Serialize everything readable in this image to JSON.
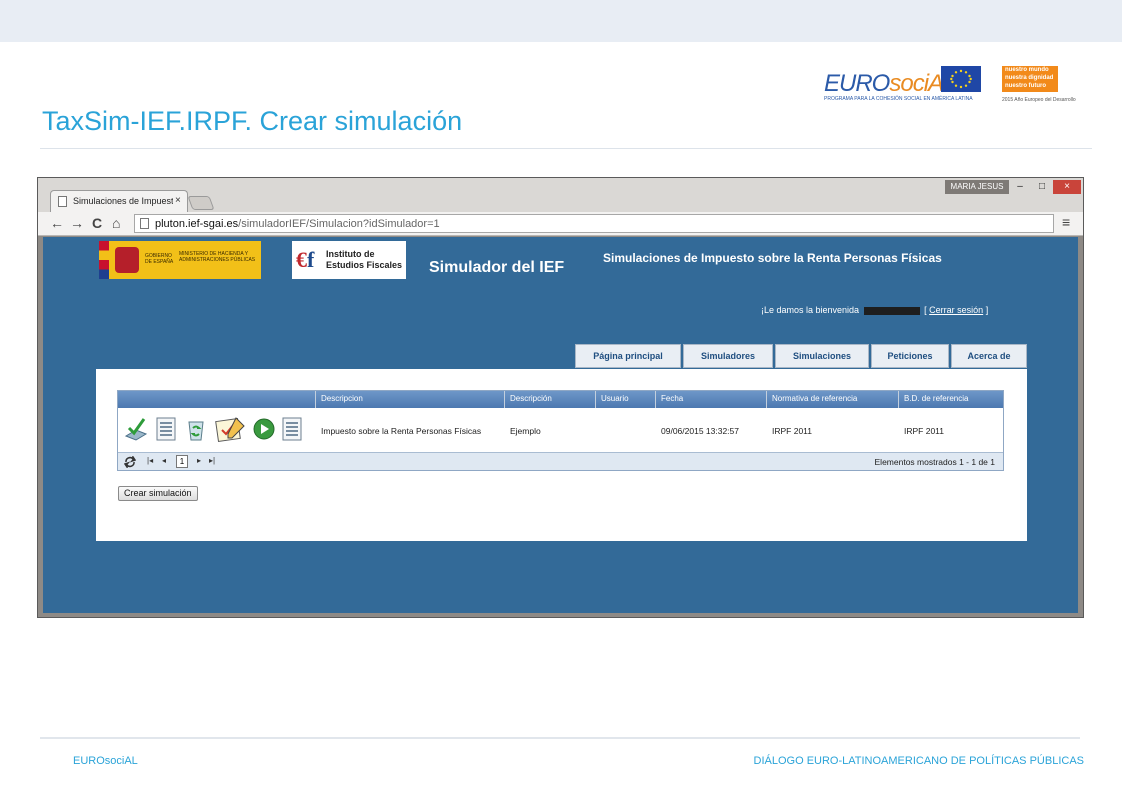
{
  "slide": {
    "title": "TaxSim-IEF.IRPF. Crear simulación",
    "footer_left": "EUROsociAL",
    "footer_right": "DIÁLOGO EURO-LATINOAMERICANO DE POLÍTICAS PÚBLICAS"
  },
  "logos": {
    "eurosocial_euro": "EURO",
    "eurosocial_social": "sociAL",
    "eurosocial_tagline": "PROGRAMA PARA LA COHESIÓN SOCIAL EN AMÉRICA LATINA",
    "nm_lines": [
      "nuestro mundo",
      "nuestra dignidad",
      "nuestro futuro"
    ],
    "nm_footer": "2015 Año Europeo del Desarrollo"
  },
  "browser": {
    "tab_title": "Simulaciones de Impuesto",
    "tab_close": "×",
    "user_badge": "MARIA JESUS",
    "win_min": "–",
    "win_max": "□",
    "win_close": "×",
    "nav_back": "←",
    "nav_forward": "→",
    "nav_reload": "C",
    "nav_home": "⌂",
    "url_host": "pluton.ief-sgai.es",
    "url_path": "/simuladorIEF/Simulacion?idSimulador=1",
    "star": "☆",
    "menu": "≡"
  },
  "page": {
    "gob_text_1": "GOBIERNO DE ESPAÑA",
    "gob_text_2": "MINISTERIO DE HACIENDA Y ADMINISTRACIONES PÚBLICAS",
    "ief_text": "Instituto de Estudios Fiscales",
    "simulator_title": "Simulador del IEF",
    "heading": "Simulaciones de Impuesto sobre la Renta Personas Físicas",
    "welcome": "¡Le damos la bienvenida",
    "logout_open": "[",
    "logout": "Cerrar sesión",
    "logout_close": "]",
    "tabs": [
      "Página principal",
      "Simuladores",
      "Simulaciones",
      "Peticiones",
      "Acerca de"
    ]
  },
  "grid": {
    "columns": [
      "Descripcion",
      "Descripción",
      "Usuario",
      "Fecha",
      "Normativa de referencia",
      "B.D. de referencia"
    ],
    "rows": [
      {
        "descripcion": "Impuesto sobre la Renta Personas Físicas",
        "descripcion2": "Ejemplo",
        "usuario": "",
        "fecha": "09/06/2015 13:32:57",
        "normativa": "IRPF 2011",
        "bd": "IRPF 2011"
      }
    ],
    "pager": {
      "first": "|◂",
      "prev": "◂",
      "page": "1",
      "next": "▸",
      "last": "▸|",
      "records": "Elementos mostrados 1 - 1 de 1"
    },
    "refresh_icon": "refresh-icon"
  },
  "actions": {
    "create_button": "Crear simulación"
  },
  "colors": {
    "accent": "#2aa3d8",
    "page_blue": "#336a98",
    "grid_header": "#4c78b0"
  }
}
